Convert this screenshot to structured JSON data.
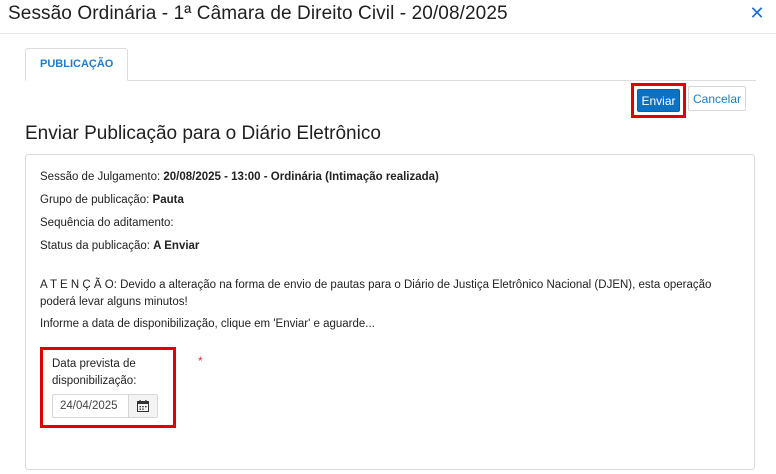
{
  "dialog": {
    "title": "Sessão Ordinária - 1ª Câmara de Direito Civil - 20/08/2025",
    "close_icon": "close-icon"
  },
  "tabs": [
    {
      "label": "PUBLICAÇÃO",
      "active": true
    }
  ],
  "toolbar": {
    "send_label": "Enviar",
    "cancel_label": "Cancelar"
  },
  "section": {
    "title": "Enviar Publicação para o Diário Eletrônico"
  },
  "details": {
    "session_label": "Sessão de Julgamento: ",
    "session_value": "20/08/2025 - 13:00 - Ordinária (Intimação realizada)",
    "group_label": "Grupo de publicação: ",
    "group_value": "Pauta",
    "sequence_label": "Sequência do aditamento:",
    "sequence_value": "",
    "status_label": "Status da publicação: ",
    "status_value": "A Enviar"
  },
  "warning": "A T E N Ç Ã O: Devido a alteração na forma de envio de pautas para o Diário de Justiça Eletrônico Nacional (DJEN), esta operação poderá levar alguns minutos!",
  "instruction": "Informe a data de disponibilização, clique em 'Enviar' e aguarde...",
  "date_field": {
    "label": "Data prevista de disponibilização:",
    "value": "24/04/2025",
    "required_mark": "*",
    "calendar_icon": "calendar-icon"
  },
  "colors": {
    "primary": "#0a71c3",
    "link": "#1f7cc8",
    "highlight": "#e00000",
    "required": "#e03030"
  }
}
